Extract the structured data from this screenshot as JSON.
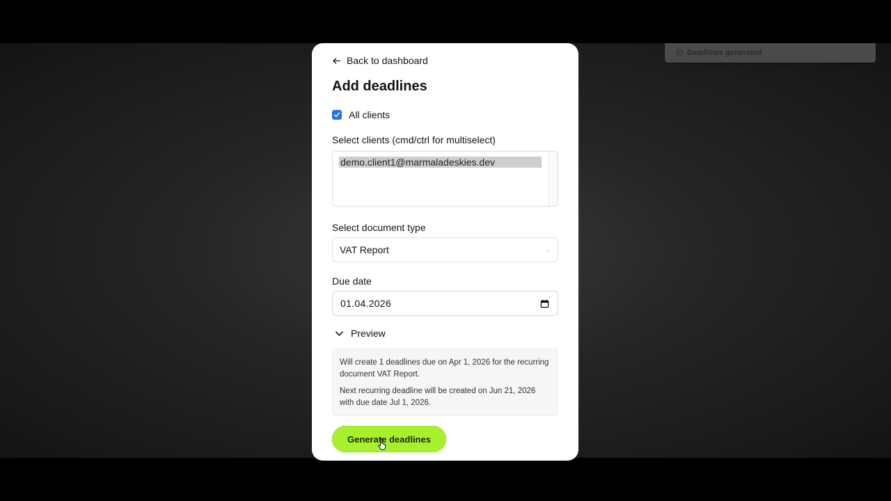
{
  "toast": {
    "text": "Deadlines generated",
    "icon": "check-circle-icon"
  },
  "nav": {
    "back_label": "Back to dashboard",
    "back_icon": "arrow-left-icon"
  },
  "page": {
    "title": "Add deadlines"
  },
  "form": {
    "all_clients": {
      "label": "All clients",
      "checked": true
    },
    "clients": {
      "label": "Select clients (cmd/ctrl for multiselect)",
      "options": [
        "demo.client1@marmaladeskies.dev"
      ],
      "selected": "demo.client1@marmaladeskies.dev"
    },
    "document_type": {
      "label": "Select document type",
      "value": "VAT Report"
    },
    "due_date": {
      "label": "Due date",
      "value": "01.04.2026"
    },
    "preview": {
      "label": "Preview",
      "expanded": true,
      "line1": "Will create 1 deadlines due on Apr 1, 2026 for the recurring document VAT Report.",
      "line2": "Next recurring deadline will be created on Jun 21, 2026 with due date Jul 1, 2026."
    },
    "submit_label": "Generate deadlines"
  },
  "colors": {
    "accent": "#a6f12c",
    "checkbox": "#1a73e8",
    "background": "#262626"
  }
}
